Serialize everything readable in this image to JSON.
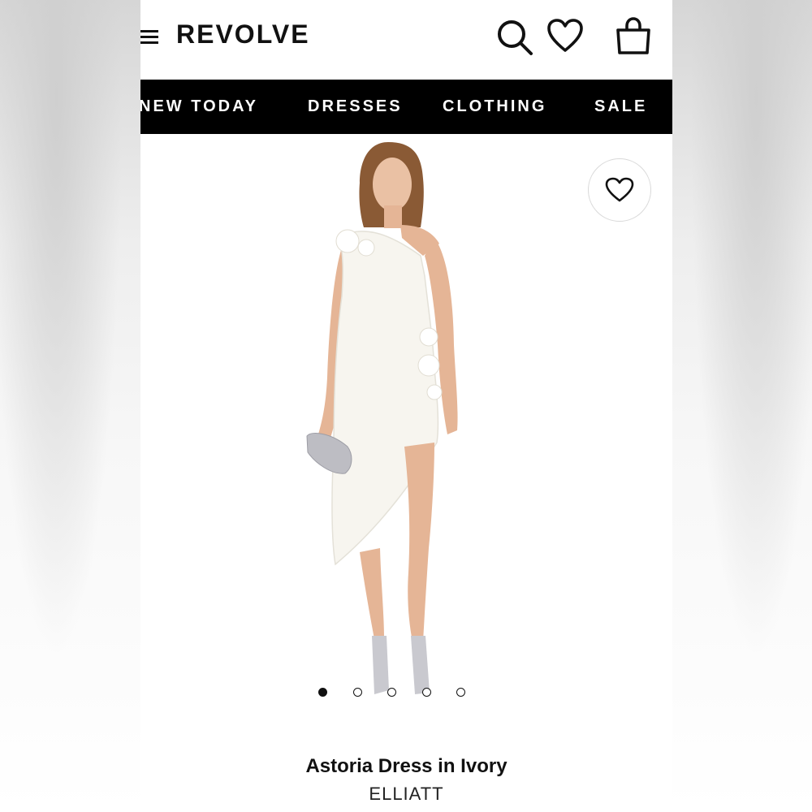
{
  "header": {
    "logo": "REVOLVE",
    "icons": [
      "menu-icon",
      "search-icon",
      "heart-icon",
      "shopping-bag-icon"
    ]
  },
  "nav": {
    "items": [
      {
        "label": "NEW TODAY"
      },
      {
        "label": "DRESSES"
      },
      {
        "label": "CLOTHING"
      },
      {
        "label": "SALE"
      }
    ]
  },
  "gallery": {
    "slide_count": 5,
    "active_index": 0,
    "favorite_icon": "heart-icon"
  },
  "product": {
    "title": "Astoria Dress in Ivory",
    "brand": "ELLIATT",
    "colors": {
      "dress": "#f7f5ef",
      "skin": "#e8b89a",
      "hair": "#8a5a35",
      "clutch": "#bdbdc3"
    }
  },
  "colors": {
    "accent": "#000000",
    "background": "#ffffff"
  }
}
